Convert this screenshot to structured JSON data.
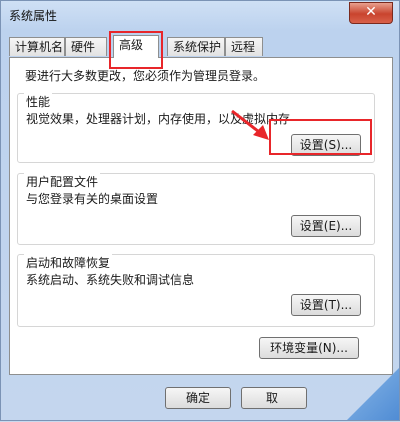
{
  "window": {
    "title": "系统属性",
    "close_glyph": "✕"
  },
  "tabs": [
    "计算机名",
    "硬件",
    "高级",
    "系统保护",
    "远程"
  ],
  "admin_note": "要进行大多数更改，您必须作为管理员登录。",
  "groups": {
    "performance": {
      "title": "性能",
      "desc": "视觉效果，处理器计划，内存使用，以及虚拟内存",
      "button": "设置(S)..."
    },
    "profiles": {
      "title": "用户配置文件",
      "desc": "与您登录有关的桌面设置",
      "button": "设置(E)..."
    },
    "startup": {
      "title": "启动和故障恢复",
      "desc": "系统启动、系统失败和调试信息",
      "button": "设置(T)..."
    }
  },
  "env_button": "环境变量(N)...",
  "footer": {
    "ok": "确定",
    "cancel": "取"
  },
  "annotations": {
    "highlight_color": "#e8262a"
  }
}
